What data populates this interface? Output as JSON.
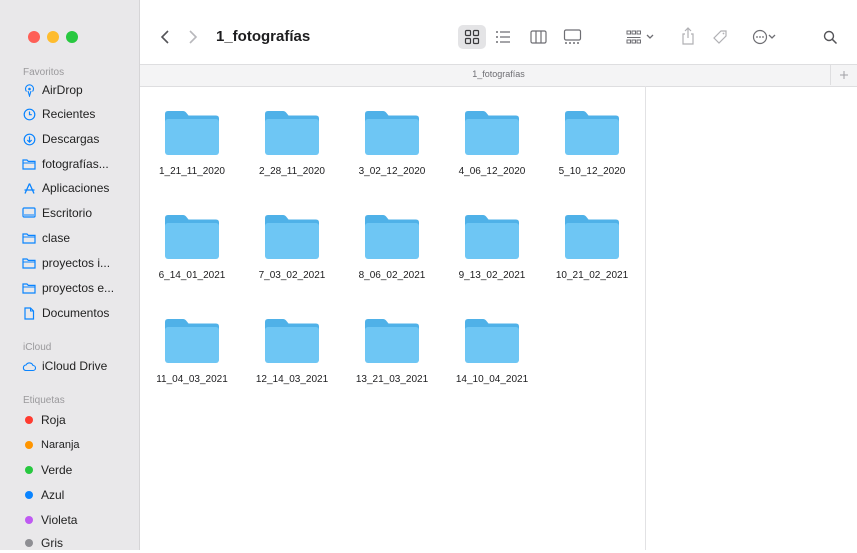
{
  "window": {
    "title": "1_fotografías",
    "path_label": "1_fotografías"
  },
  "toolbar": {
    "back_icon": "chevron-left",
    "forward_icon": "chevron-right",
    "views": [
      "icon-view",
      "list-view",
      "column-view",
      "gallery-view"
    ],
    "selected_view": "icon-view"
  },
  "sidebar": {
    "favorites_title": "Favoritos",
    "favorites": [
      {
        "label": "AirDrop",
        "icon": "airdrop-icon"
      },
      {
        "label": "Recientes",
        "icon": "clock-icon"
      },
      {
        "label": "Descargas",
        "icon": "download-icon"
      },
      {
        "label": "fotografías...",
        "icon": "folder-icon"
      },
      {
        "label": "Aplicaciones",
        "icon": "apps-icon"
      },
      {
        "label": "Escritorio",
        "icon": "desktop-icon"
      },
      {
        "label": "clase",
        "icon": "folder-icon"
      },
      {
        "label": "proyectos i...",
        "icon": "folder-icon"
      },
      {
        "label": "proyectos e...",
        "icon": "folder-icon"
      },
      {
        "label": "Documentos",
        "icon": "document-icon"
      }
    ],
    "icloud_title": "iCloud",
    "icloud": [
      {
        "label": "iCloud Drive",
        "icon": "cloud-icon"
      }
    ],
    "tags_title": "Etiquetas",
    "tags": [
      {
        "label": "Roja",
        "color": "#ff3b30"
      },
      {
        "label": "Naranja",
        "color": "#ff9500"
      },
      {
        "label": "Verde",
        "color": "#28c840"
      },
      {
        "label": "Azul",
        "color": "#0a84ff"
      },
      {
        "label": "Violeta",
        "color": "#bf5af2"
      },
      {
        "label": "Gris",
        "color": "#8e8e93"
      }
    ]
  },
  "folders": [
    "1_21_11_2020",
    "2_28_11_2020",
    "3_02_12_2020",
    "4_06_12_2020",
    "5_10_12_2020",
    "6_14_01_2021",
    "7_03_02_2021",
    "8_06_02_2021",
    "9_13_02_2021",
    "10_21_02_2021",
    "11_04_03_2021",
    "12_14_03_2021",
    "13_21_03_2021",
    "14_10_04_2021"
  ],
  "colors": {
    "folder_body": "#6ec6f4",
    "folder_tab": "#4fb1e8",
    "accent": "#0a84ff"
  }
}
